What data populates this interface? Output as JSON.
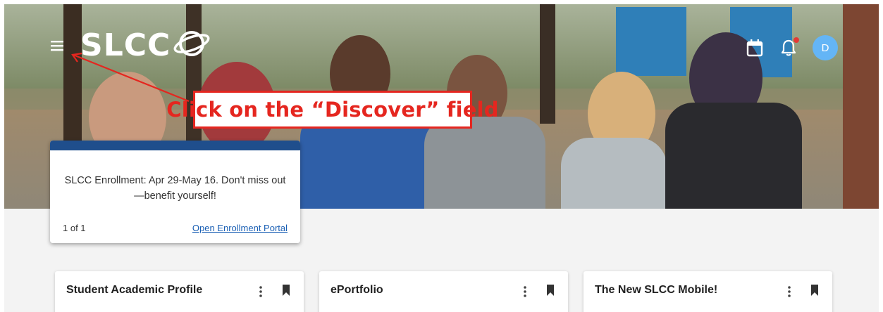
{
  "header": {
    "logo_text": "SLCC",
    "avatar_initial": "D",
    "icons": [
      "menu-icon",
      "calendar-icon",
      "bell-icon"
    ]
  },
  "instruction": {
    "text": "Click on the “Discover” field"
  },
  "notice": {
    "message": "SLCC Enrollment: Apr 29-May 16. Don't miss out—benefit yourself!",
    "counter": "1 of 1",
    "link": "Open Enrollment Portal"
  },
  "cards": [
    {
      "title": "Student Academic Profile"
    },
    {
      "title": "ePortfolio"
    },
    {
      "title": "The New SLCC Mobile!"
    }
  ],
  "colors": {
    "accent_red": "#e5261f",
    "notice_bar": "#1f4e8c",
    "avatar": "#64b5f6",
    "link": "#1a5fb4"
  }
}
